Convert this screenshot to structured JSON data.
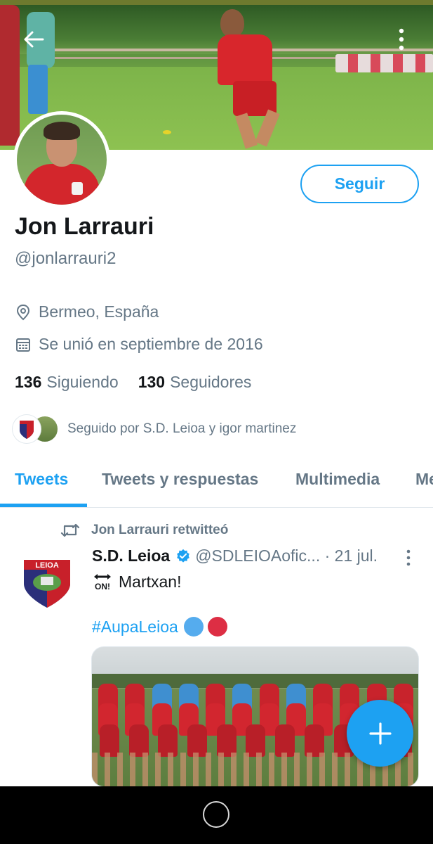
{
  "profile": {
    "name": "Jon Larrauri",
    "handle": "@jonlarrauri2",
    "follow_label": "Seguir",
    "location": "Bermeo, España",
    "joined": "Se unió en septiembre de 2016",
    "following_count": "136",
    "following_label": "Siguiendo",
    "followers_count": "130",
    "followers_label": "Seguidores",
    "followed_by": "Seguido por S.D. Leioa y igor martinez"
  },
  "tabs": [
    {
      "label": "Tweets",
      "active": true
    },
    {
      "label": "Tweets y respuestas",
      "active": false
    },
    {
      "label": "Multimedia",
      "active": false
    },
    {
      "label": "Me",
      "active": false
    }
  ],
  "tweet": {
    "retweet_label": "Jon Larrauri retwitteó",
    "author": "S.D. Leioa",
    "verified": true,
    "handle_time": "@SDLEIOAofic... · 21 jul.",
    "text": "Martxan!",
    "hashtag": "#AupaLeioa",
    "avatar_text": "LEIOA"
  },
  "icons": {
    "back": "arrow-left-icon",
    "more": "more-vertical-icon",
    "location": "location-pin-icon",
    "calendar": "calendar-icon",
    "retweet": "retweet-icon",
    "verified": "verified-badge-icon",
    "on_arrow": "on-arrow-emoji",
    "compose": "plus-icon"
  },
  "colors": {
    "accent": "#1da1f2",
    "secondary_text": "#657786",
    "primary_text": "#14171a",
    "divider": "#e1e8ed"
  }
}
